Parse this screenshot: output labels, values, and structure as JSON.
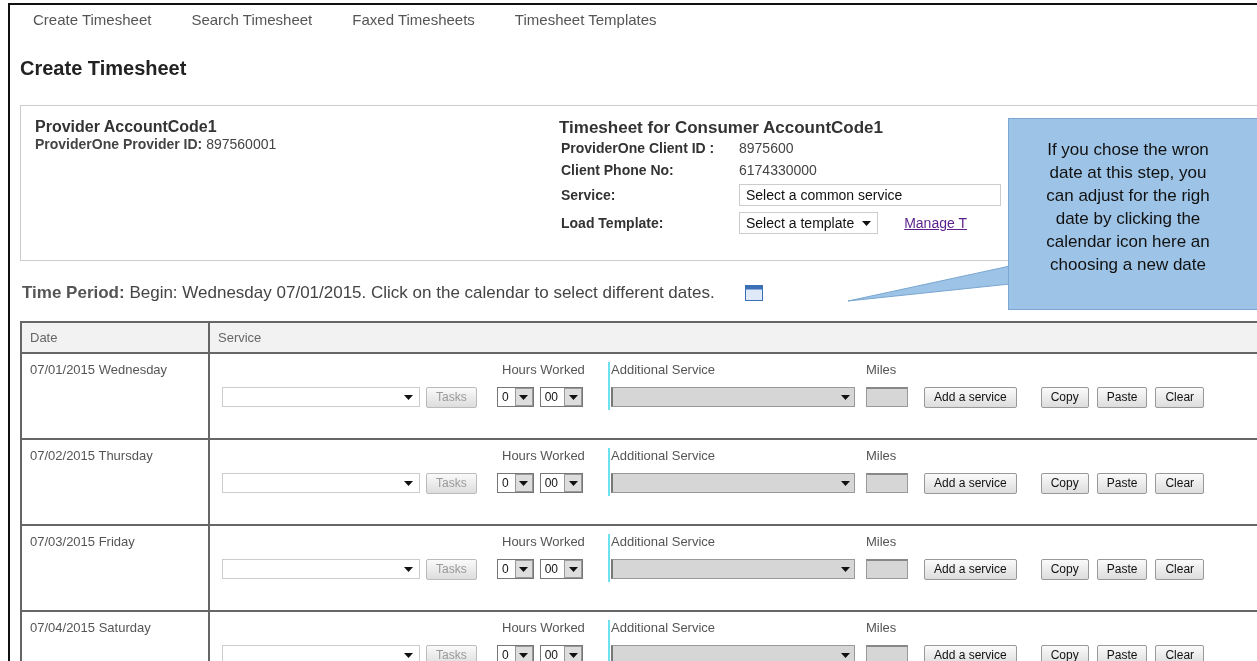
{
  "nav": [
    "Create Timesheet",
    "Search Timesheet",
    "Faxed Timesheets",
    "Timesheet Templates"
  ],
  "page_title": "Create Timesheet",
  "provider": {
    "name": "Provider AccountCode1",
    "id_line": "**ProviderOne Provider ID:** 897560001"
  },
  "consumer": {
    "title": "Timesheet for Consumer AccountCode1",
    "fields": [
      {
        "kind": "text",
        "label": "ProviderOne Client ID :",
        "value": "8975600"
      },
      {
        "kind": "text",
        "label": "Client Phone No:",
        "value": "6174330000"
      },
      {
        "kind": "select",
        "label": "Service:",
        "value": "Select a common service"
      },
      {
        "kind": "template",
        "label": "Load Template:",
        "value": "Select a template",
        "link": "Manage T"
      }
    ]
  },
  "time_period": "**Time Period:** Begin: Wednesday 07/01/2015. Click on the calendar to select different dates.",
  "table": {
    "columns": [
      "Date",
      "Service"
    ],
    "rows": [
      {
        "date": "07/01/2015 Wednesday",
        "hours_label": "Hours Worked",
        "hours": "0",
        "minutes": "00",
        "additional_label": "Additional Service",
        "miles_label": "Miles",
        "tasks": "Tasks",
        "buttons": [
          "Add a service",
          "Copy",
          "Paste",
          "Clear"
        ]
      },
      {
        "date": "07/02/2015 Thursday",
        "hours_label": "Hours Worked",
        "hours": "0",
        "minutes": "00",
        "additional_label": "Additional Service",
        "miles_label": "Miles",
        "tasks": "Tasks",
        "buttons": [
          "Add a service",
          "Copy",
          "Paste",
          "Clear"
        ]
      },
      {
        "date": "07/03/2015 Friday",
        "hours_label": "Hours Worked",
        "hours": "0",
        "minutes": "00",
        "additional_label": "Additional Service",
        "miles_label": "Miles",
        "tasks": "Tasks",
        "buttons": [
          "Add a service",
          "Copy",
          "Paste",
          "Clear"
        ]
      },
      {
        "date": "07/04/2015 Saturday",
        "hours_label": "Hours Worked",
        "hours": "0",
        "minutes": "00",
        "additional_label": "Additional Service",
        "miles_label": "Miles",
        "tasks": "Tasks",
        "buttons": [
          "Add a service",
          "Copy",
          "Paste",
          "Clear"
        ]
      }
    ]
  },
  "callout": {
    "lines": [
      "If you chose the wron",
      "date at this step, you",
      "can adjust for the righ",
      "date by clicking the",
      "calendar icon here an",
      "choosing a new date"
    ]
  }
}
